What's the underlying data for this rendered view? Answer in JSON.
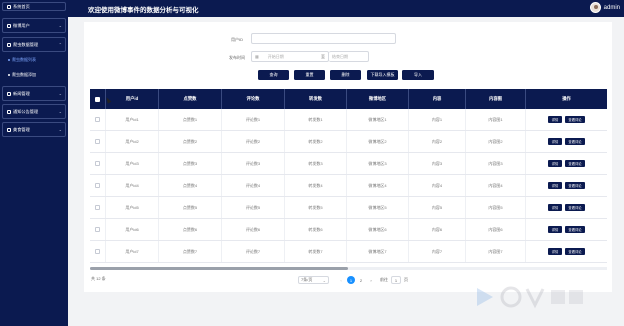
{
  "header": {
    "title": "欢迎使用微博事件的数据分析与可视化",
    "username": "admin"
  },
  "sidebar": {
    "items": [
      {
        "label": "系统首页"
      },
      {
        "label": "微博用户"
      },
      {
        "label": "爬虫数据管理"
      },
      {
        "label": "爬虫数据列表"
      },
      {
        "label": "爬虫数据添加"
      },
      {
        "label": "新闻管理"
      },
      {
        "label": "通知公告管理"
      },
      {
        "label": "美食管理"
      }
    ]
  },
  "filters": {
    "user_label": "用户ID",
    "date_label": "发布时间",
    "start_placeholder": "开始日期",
    "to_label": "至",
    "end_placeholder": "结束日期"
  },
  "toolbar": {
    "query": "查询",
    "reset": "重置",
    "delete": "删除",
    "template": "下载导入模板",
    "import": "导入"
  },
  "table": {
    "headers": [
      "用户id",
      "点赞数",
      "评论数",
      "转发数",
      "微博地区",
      "内容",
      "内容图",
      "操作"
    ],
    "rows": [
      {
        "user": "用户id1",
        "likes": "点赞数1",
        "comments": "评论数1",
        "reposts": "转发数1",
        "region": "微博地区1",
        "content": "内容1",
        "image": "内容图1"
      },
      {
        "user": "用户id2",
        "likes": "点赞数2",
        "comments": "评论数2",
        "reposts": "转发数2",
        "region": "微博地区2",
        "content": "内容2",
        "image": "内容图2"
      },
      {
        "user": "用户id3",
        "likes": "点赞数3",
        "comments": "评论数3",
        "reposts": "转发数3",
        "region": "微博地区3",
        "content": "内容3",
        "image": "内容图3"
      },
      {
        "user": "用户id4",
        "likes": "点赞数4",
        "comments": "评论数4",
        "reposts": "转发数4",
        "region": "微博地区4",
        "content": "内容4",
        "image": "内容图4"
      },
      {
        "user": "用户id5",
        "likes": "点赞数5",
        "comments": "评论数5",
        "reposts": "转发数5",
        "region": "微博地区5",
        "content": "内容5",
        "image": "内容图5"
      },
      {
        "user": "用户id6",
        "likes": "点赞数6",
        "comments": "评论数6",
        "reposts": "转发数6",
        "region": "微博地区6",
        "content": "内容6",
        "image": "内容图6"
      },
      {
        "user": "用户id7",
        "likes": "点赞数7",
        "comments": "评论数7",
        "reposts": "转发数7",
        "region": "微博地区7",
        "content": "内容7",
        "image": "内容图7"
      }
    ],
    "action_detail": "详情",
    "action_view_comments": "查看评论"
  },
  "pagination": {
    "total": "共 12 条",
    "page_size": "7条/页",
    "prev": "‹",
    "pages": [
      "1",
      "2"
    ],
    "next": "›",
    "goto_label": "前往",
    "goto_value": "1",
    "goto_unit": "页"
  },
  "theme": {
    "primary": "#0b1a50",
    "accent": "#1890ff"
  }
}
